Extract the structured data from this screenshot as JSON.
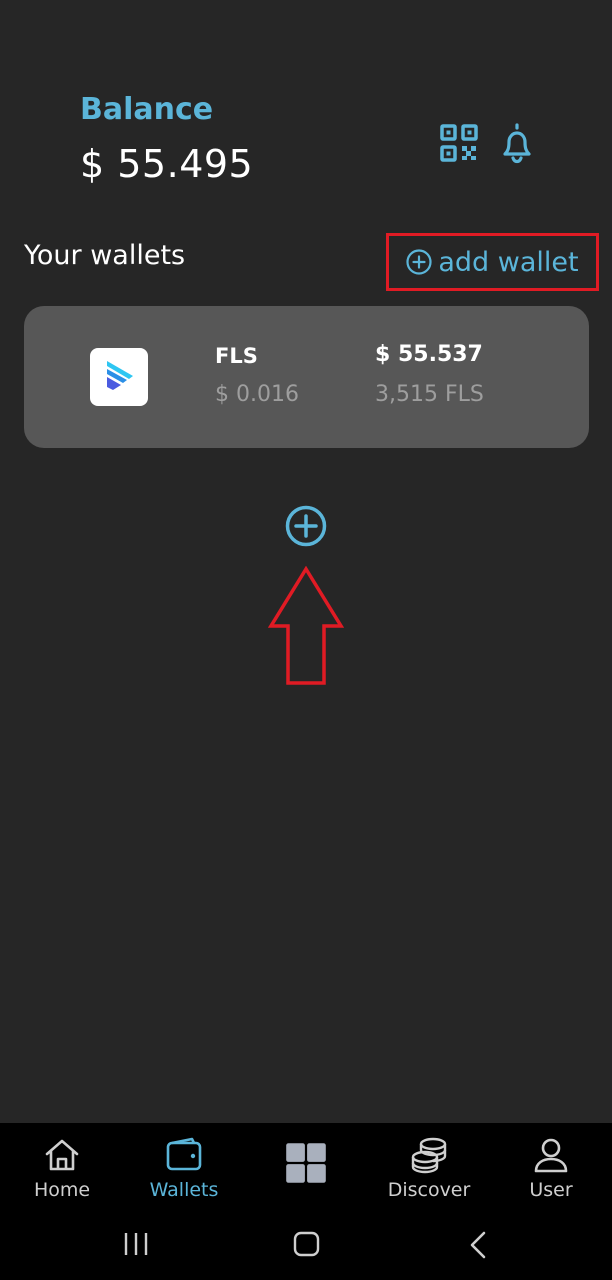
{
  "header": {
    "balance_label": "Balance",
    "balance_value": "$ 55.495",
    "icons": [
      "qr-code-icon",
      "bell-icon"
    ]
  },
  "wallets": {
    "title": "Your wallets",
    "add_label": "add wallet",
    "items": [
      {
        "symbol": "FLS",
        "price": "$ 0.016",
        "value": "$ 55.537",
        "amount": "3,515 FLS",
        "icon": "fls-token-logo"
      }
    ]
  },
  "nav": {
    "items": [
      {
        "label": "Home",
        "icon": "home-icon"
      },
      {
        "label": "Wallets",
        "icon": "wallet-icon",
        "active": true
      },
      {
        "label": "",
        "icon": "grid-icon"
      },
      {
        "label": "Discover",
        "icon": "coins-stack-icon"
      },
      {
        "label": "User",
        "icon": "user-icon"
      }
    ]
  },
  "colors": {
    "background": "#262626",
    "accent": "#5bb5d9",
    "card": "#575757",
    "highlight": "#e01b24"
  }
}
